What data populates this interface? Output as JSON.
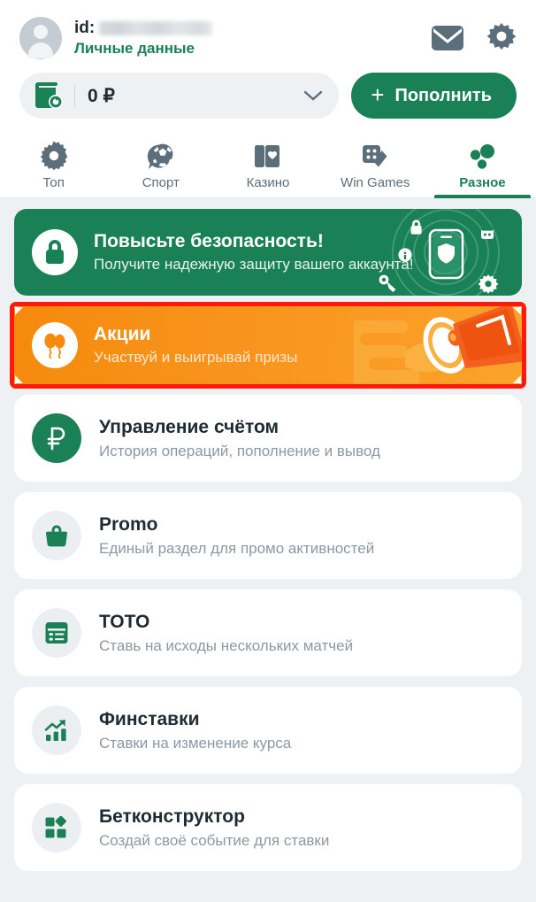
{
  "header": {
    "avatar_name": "user-avatar",
    "id_label": "id:",
    "id_value_masked": "",
    "personal_data_link": "Личные данные",
    "mail_icon": "envelope-icon",
    "settings_icon": "gear-icon"
  },
  "balance": {
    "wallet_icon": "wallet-refresh-icon",
    "amount": "0 ₽",
    "dropdown_icon": "chevron-down-icon",
    "topup_label": "Пополнить",
    "topup_plus": "+"
  },
  "tabs": [
    {
      "label": "Топ",
      "icon": "star-burst-icon",
      "active": false
    },
    {
      "label": "Спорт",
      "icon": "soccer-ball-icon",
      "active": false
    },
    {
      "label": "Казино",
      "icon": "playing-cards-icon",
      "active": false
    },
    {
      "label": "Win Games",
      "icon": "dice-icon",
      "active": false
    },
    {
      "label": "Разное",
      "icon": "dots-cluster-icon",
      "active": true
    }
  ],
  "banners": [
    {
      "id": "security",
      "icon": "lock-icon",
      "title": "Повысьте безопасность!",
      "subtitle": "Получите надежную защиту вашего аккаунта!",
      "art": "phone-shield-icon",
      "bg_color": "#1a8157",
      "selected": false
    },
    {
      "id": "promotions",
      "icon": "balloons-icon",
      "title": "Акции",
      "subtitle": "Участвуй и выигрывай призы",
      "art": "megaphone-icon",
      "bg_color": "#f8941d",
      "selected": true,
      "selection_color": "#fc1b0b"
    }
  ],
  "menu_items": [
    {
      "title": "Управление счётом",
      "subtitle": "История операций, пополнение и вывод",
      "icon": "ruble-icon",
      "icon_style": "solid"
    },
    {
      "title": "Promo",
      "subtitle": "Единый раздел для промо активностей",
      "icon": "shopping-bag-icon",
      "icon_style": "light"
    },
    {
      "title": "ТОТО",
      "subtitle": "Ставь на исходы нескольких матчей",
      "icon": "table-list-icon",
      "icon_style": "light"
    },
    {
      "title": "Финставки",
      "subtitle": "Ставки на изменение курса",
      "icon": "chart-arrow-icon",
      "icon_style": "light"
    },
    {
      "title": "Бетконструктор",
      "subtitle": "Создай своё событие для ставки",
      "icon": "blocks-icon",
      "icon_style": "light"
    }
  ],
  "theme": {
    "accent_green": "#1a8157",
    "page_background": "#eef1f4",
    "card_background": "#ffffff",
    "muted_text": "#8b98a3",
    "icon_gray": "#5c6e7a"
  }
}
